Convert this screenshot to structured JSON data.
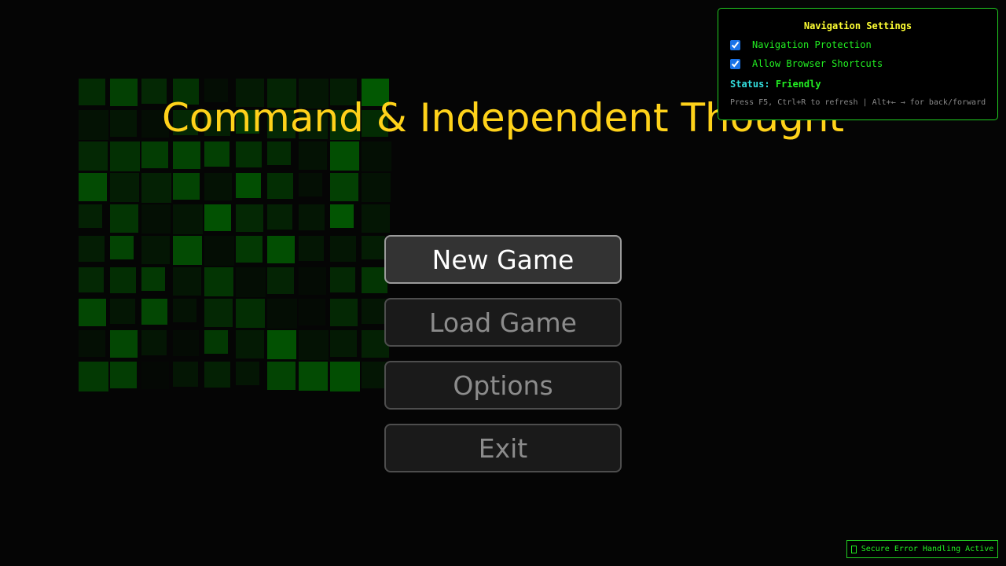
{
  "title": "Command & Independent Thought",
  "menu": {
    "items": [
      {
        "label": "New Game",
        "state": "selected"
      },
      {
        "label": "Load Game",
        "state": "normal"
      },
      {
        "label": "Options",
        "state": "normal"
      },
      {
        "label": "Exit",
        "state": "normal"
      }
    ]
  },
  "nav_settings": {
    "title": "Navigation Settings",
    "options": [
      {
        "label": "Navigation Protection",
        "checked": true
      },
      {
        "label": "Allow Browser Shortcuts",
        "checked": true
      }
    ],
    "status_label": "Status:",
    "status_value": "Friendly",
    "hint": "Press F5, Ctrl+R to refresh | Alt+← → for back/forward"
  },
  "secure_badge": {
    "icon": "lock-icon",
    "text": "Secure Error Handling Active"
  },
  "colors": {
    "background": "#050505",
    "title": "#ffd21a",
    "panel_accent": "#22ee22",
    "panel_title": "#ffff33",
    "status_label": "#33dddd",
    "tile_green": "#00b400"
  },
  "background_tiles": {
    "grid": "10x10",
    "intensity": [
      [
        0.22,
        0.34,
        0.2,
        0.26,
        0.05,
        0.12,
        0.18,
        0.1,
        0.14,
        0.48
      ],
      [
        0.08,
        0.1,
        0.05,
        0.2,
        0.15,
        0.3,
        0.2,
        0.14,
        0.25,
        0.22
      ],
      [
        0.2,
        0.25,
        0.32,
        0.36,
        0.34,
        0.25,
        0.22,
        0.08,
        0.42,
        0.06
      ],
      [
        0.4,
        0.14,
        0.16,
        0.36,
        0.08,
        0.42,
        0.24,
        0.06,
        0.34,
        0.08
      ],
      [
        0.16,
        0.28,
        0.06,
        0.1,
        0.44,
        0.2,
        0.16,
        0.1,
        0.46,
        0.1
      ],
      [
        0.14,
        0.36,
        0.1,
        0.4,
        0.05,
        0.3,
        0.42,
        0.1,
        0.1,
        0.14
      ],
      [
        0.2,
        0.24,
        0.3,
        0.1,
        0.28,
        0.05,
        0.18,
        0.04,
        0.2,
        0.28
      ],
      [
        0.38,
        0.1,
        0.38,
        0.08,
        0.2,
        0.24,
        0.05,
        0.03,
        0.2,
        0.1
      ],
      [
        0.06,
        0.38,
        0.1,
        0.04,
        0.3,
        0.12,
        0.44,
        0.08,
        0.12,
        0.16
      ],
      [
        0.3,
        0.32,
        0.02,
        0.1,
        0.16,
        0.1,
        0.36,
        0.4,
        0.42,
        0.1
      ]
    ]
  }
}
